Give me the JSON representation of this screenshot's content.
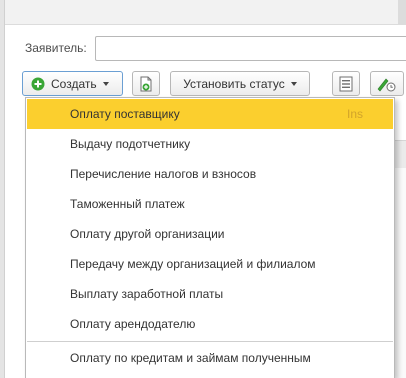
{
  "form": {
    "applicant_label": "Заявитель:",
    "applicant_value": ""
  },
  "toolbar": {
    "create_label": "Создать",
    "set_status_label": "Установить статус"
  },
  "create_menu": {
    "items": [
      {
        "label": "Оплату поставщику",
        "shortcut": "Ins",
        "selected": true
      },
      {
        "label": "Выдачу подотчетнику"
      },
      {
        "label": "Перечисление налогов и взносов"
      },
      {
        "label": "Таможенный платеж"
      },
      {
        "label": "Оплату другой организации"
      },
      {
        "label": "Передачу между организацией и филиалом"
      },
      {
        "label": "Выплату заработной платы"
      },
      {
        "label": "Оплату арендодателю"
      },
      {
        "label": "Оплату по кредитам и займам полученным"
      }
    ]
  },
  "colors": {
    "selected_item": "#fbcf2e",
    "create_icon": "#3aa636",
    "create_border": "#6b9fd3"
  },
  "icons": [
    "plus-circle-icon",
    "copy-document-icon",
    "list-icon",
    "edit-pen-icon",
    "chevron-down-icon"
  ]
}
